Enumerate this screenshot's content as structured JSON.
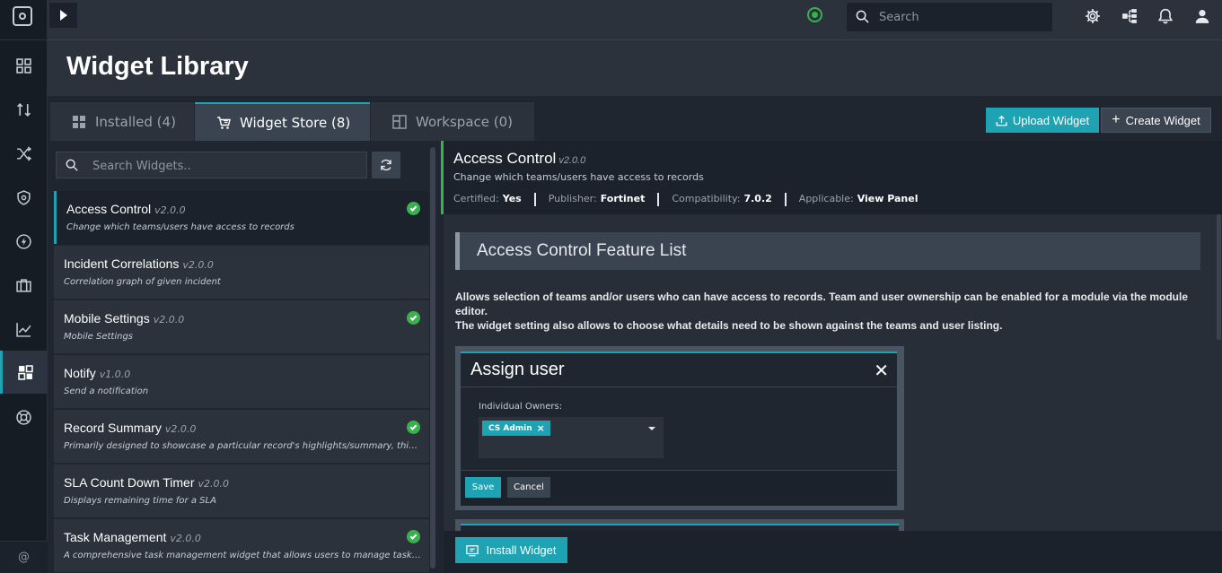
{
  "topbar": {
    "search_placeholder": "Search"
  },
  "page": {
    "title": "Widget Library"
  },
  "tabs": [
    {
      "label": "Installed (4)"
    },
    {
      "label": "Widget Store (8)"
    },
    {
      "label": "Workspace (0)"
    }
  ],
  "actions": {
    "upload_label": "Upload Widget",
    "create_label": "Create Widget"
  },
  "list": {
    "search_placeholder": "Search Widgets..",
    "items": [
      {
        "name": "Access Control",
        "version": "v2.0.0",
        "desc": "Change which teams/users have access to records",
        "installed": true
      },
      {
        "name": "Incident Correlations",
        "version": "v2.0.0",
        "desc": "Correlation graph of given incident",
        "installed": false
      },
      {
        "name": "Mobile Settings",
        "version": "v2.0.0",
        "desc": "Mobile Settings",
        "installed": true
      },
      {
        "name": "Notify",
        "version": "v1.0.0",
        "desc": "Send a notification",
        "installed": false
      },
      {
        "name": "Record Summary",
        "version": "v2.0.0",
        "desc": "Primarily designed to showcase a particular record's highlights/summary, this wi...",
        "installed": true
      },
      {
        "name": "SLA Count Down Timer",
        "version": "v2.0.0",
        "desc": "Displays remaining time for a SLA",
        "installed": false
      },
      {
        "name": "Task Management",
        "version": "v2.0.0",
        "desc": "A comprehensive task management widget that allows users to manage tasks an...",
        "installed": true
      }
    ]
  },
  "detail": {
    "title": "Access Control",
    "version": "v2.0.0",
    "subtitle": "Change which teams/users have access to records",
    "meta": {
      "certified_label": "Certified:",
      "certified_value": "Yes",
      "publisher_label": "Publisher:",
      "publisher_value": "Fortinet",
      "compat_label": "Compatibility:",
      "compat_value": "7.0.2",
      "applicable_label": "Applicable:",
      "applicable_value": "View Panel"
    },
    "feature_heading": "Access Control Feature List",
    "feature_text_1": "Allows selection of teams and/or users who can have access to records. Team and user ownership can be enabled for a module via the module editor.",
    "feature_text_2": "The widget setting also allows to choose what details need to be shown against the teams and user listing.",
    "screenshot": {
      "title": "Assign user",
      "close": "✕",
      "field_label": "Individual Owners:",
      "chip": "CS Admin",
      "chip_remove": "×",
      "save": "Save",
      "cancel": "Cancel"
    },
    "install_label": "Install Widget"
  },
  "footer": {
    "at_symbol": "@"
  },
  "colors": {
    "accent": "#1fa3b3",
    "success": "#37b24d"
  }
}
